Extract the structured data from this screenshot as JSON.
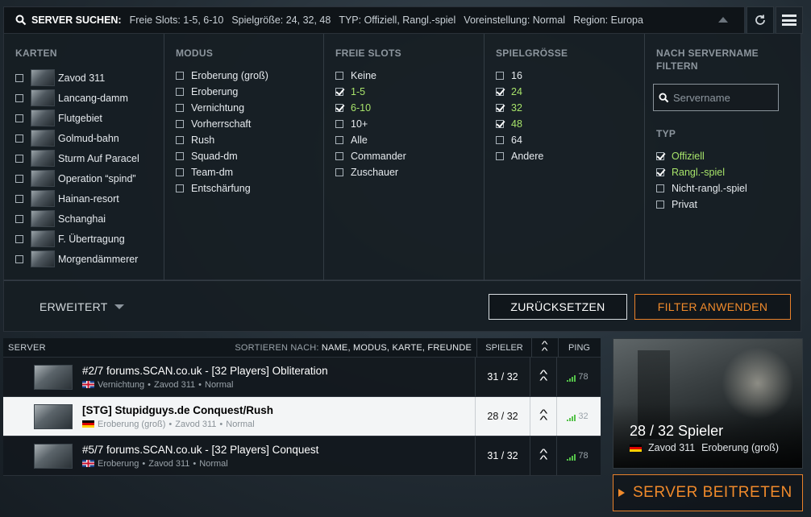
{
  "search": {
    "label": "SERVER SUCHEN:",
    "summary": {
      "slots": "Freie Slots: 1-5, 6-10",
      "size": "Spielgröße: 24, 32, 48",
      "type": "TYP: Offiziell, Rangl.-spiel",
      "preset": "Voreinstellung: Normal",
      "region": "Region: Europa"
    },
    "icon": "search-icon",
    "refresh_icon": "refresh-icon",
    "menu_icon": "menu-icon"
  },
  "filters": {
    "maps": {
      "heading": "KARTEN",
      "items": [
        {
          "label": "Zavod 311",
          "checked": false
        },
        {
          "label": "Lancang-damm",
          "checked": false
        },
        {
          "label": "Flutgebiet",
          "checked": false
        },
        {
          "label": "Golmud-bahn",
          "checked": false
        },
        {
          "label": "Sturm Auf Paracel",
          "checked": false
        },
        {
          "label": "Operation “spind”",
          "checked": false
        },
        {
          "label": "Hainan-resort",
          "checked": false
        },
        {
          "label": "Schanghai",
          "checked": false
        },
        {
          "label": "F. Übertragung",
          "checked": false
        },
        {
          "label": "Morgendämmerer",
          "checked": false
        }
      ]
    },
    "modes": {
      "heading": "MODUS",
      "items": [
        {
          "label": "Eroberung (groß)",
          "checked": false
        },
        {
          "label": "Eroberung",
          "checked": false
        },
        {
          "label": "Vernichtung",
          "checked": false
        },
        {
          "label": "Vorherrschaft",
          "checked": false
        },
        {
          "label": "Rush",
          "checked": false
        },
        {
          "label": "Squad-dm",
          "checked": false
        },
        {
          "label": "Team-dm",
          "checked": false
        },
        {
          "label": "Entschärfung",
          "checked": false
        }
      ]
    },
    "slots": {
      "heading": "FREIE SLOTS",
      "items": [
        {
          "label": "Keine",
          "checked": false
        },
        {
          "label": "1-5",
          "checked": true
        },
        {
          "label": "6-10",
          "checked": true
        },
        {
          "label": "10+",
          "checked": false
        },
        {
          "label": "Alle",
          "checked": false
        },
        {
          "label": "Commander",
          "checked": false
        },
        {
          "label": "Zuschauer",
          "checked": false
        }
      ]
    },
    "size": {
      "heading": "SPIELGRÖSSE",
      "items": [
        {
          "label": "16",
          "checked": false
        },
        {
          "label": "24",
          "checked": true
        },
        {
          "label": "32",
          "checked": true
        },
        {
          "label": "48",
          "checked": true
        },
        {
          "label": "64",
          "checked": false
        },
        {
          "label": "Andere",
          "checked": false
        }
      ]
    },
    "name": {
      "heading": "NACH SERVERNAME FILTERN",
      "placeholder": "Servername",
      "value": ""
    },
    "type": {
      "heading": "TYP",
      "items": [
        {
          "label": "Offiziell",
          "checked": true
        },
        {
          "label": "Rangl.-spiel",
          "checked": true
        },
        {
          "label": "Nicht-rangl.-spiel",
          "checked": false
        },
        {
          "label": "Privat",
          "checked": false
        }
      ]
    }
  },
  "actions": {
    "advanced": "ERWEITERT",
    "reset": "ZURÜCKSETZEN",
    "apply": "FILTER ANWENDEN"
  },
  "list": {
    "head_server": "SERVER",
    "sort_prefix": "SORTIEREN NACH:",
    "sort_options": "NAME, MODUS, KARTE, FREUNDE",
    "head_players": "SPIELER",
    "head_ping": "PING",
    "rows": [
      {
        "title": "#2/7 forums.SCAN.co.uk - [32 Players] Obliteration",
        "flag": "uk",
        "mode": "Vernichtung",
        "map": "Zavod 311",
        "preset": "Normal",
        "players": "31 / 32",
        "ping": "78",
        "selected": false
      },
      {
        "title": "[STG] Stupidguys.de Conquest/Rush",
        "flag": "de",
        "mode": "Eroberung (groß)",
        "map": "Zavod 311",
        "preset": "Normal",
        "players": "28 / 32",
        "ping": "32",
        "selected": true
      },
      {
        "title": "#5/7 forums.SCAN.co.uk - [32 Players] Conquest",
        "flag": "uk",
        "mode": "Eroberung",
        "map": "Zavod 311",
        "preset": "Normal",
        "players": "31 / 32",
        "ping": "78",
        "selected": false
      }
    ]
  },
  "preview": {
    "players": "28 / 32 Spieler",
    "map": "Zavod 311",
    "mode": "Eroberung (groß)",
    "join": "SERVER BEITRETEN"
  },
  "colors": {
    "accent": "#f08a2b",
    "checked_text": "#a7e36a",
    "ping_bars": "#55c24a",
    "selected_row": "#f3f5f6"
  }
}
